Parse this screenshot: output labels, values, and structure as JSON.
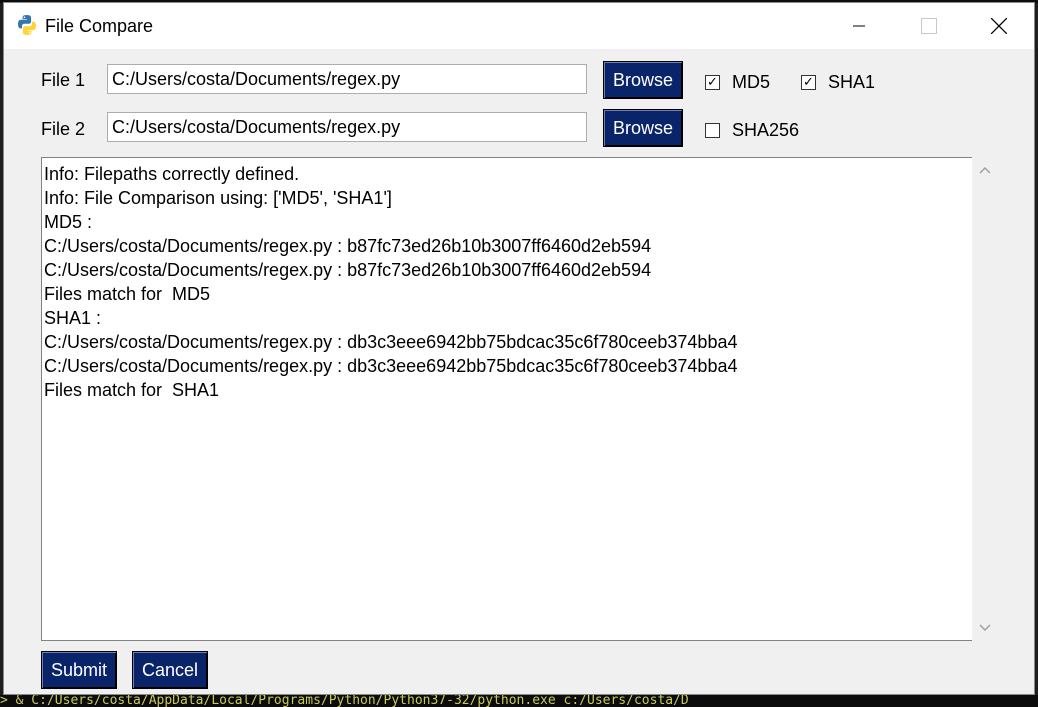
{
  "window": {
    "title": "File Compare"
  },
  "form": {
    "file1": {
      "label": "File 1",
      "value": "C:/Users/costa/Documents/regex.py"
    },
    "file2": {
      "label": "File 2",
      "value": "C:/Users/costa/Documents/regex.py"
    },
    "browse_label": "Browse",
    "checks": {
      "md5": {
        "label": "MD5",
        "checked": true
      },
      "sha1": {
        "label": "SHA1",
        "checked": true
      },
      "sha256": {
        "label": "SHA256",
        "checked": false
      }
    }
  },
  "output": {
    "lines": [
      "Info: Filepaths correctly defined.",
      "Info: File Comparison using: ['MD5', 'SHA1']",
      "MD5 :",
      "C:/Users/costa/Documents/regex.py : b87fc73ed26b10b3007ff6460d2eb594",
      "C:/Users/costa/Documents/regex.py : b87fc73ed26b10b3007ff6460d2eb594",
      "Files match for  MD5",
      "SHA1 :",
      "C:/Users/costa/Documents/regex.py : db3c3eee6942bb75bdcac35c6f780ceeb374bba4",
      "C:/Users/costa/Documents/regex.py : db3c3eee6942bb75bdcac35c6f780ceeb374bba4",
      "Files match for  SHA1"
    ]
  },
  "actions": {
    "submit_label": "Submit",
    "cancel_label": "Cancel"
  },
  "background": {
    "terminal_text": "> & C:/Users/costa/AppData/Local/Programs/Python/Python37-32/python.exe c:/Users/costa/D"
  },
  "colors": {
    "button_bg": "#0a246a",
    "window_bg": "#f0f0f0"
  }
}
